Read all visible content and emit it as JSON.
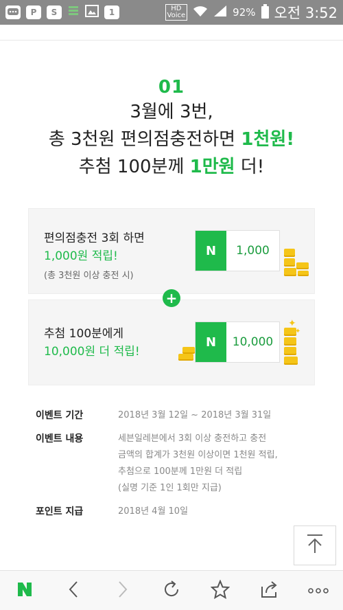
{
  "status_bar": {
    "notification_icons": [
      "chat-icon",
      "p-icon",
      "s-icon",
      "bars-icon",
      "image-icon",
      "one-icon"
    ],
    "one_label": "1",
    "p_label": "P",
    "s_label": "S",
    "hd_label": "HD",
    "voice_label": "Voice",
    "battery": "92%",
    "time": "오전 3:52"
  },
  "event": {
    "number": "01",
    "line1": "3월에 3번,",
    "line2_prefix": "총 3천원 편의점충전하면 ",
    "line2_highlight": "1천원!",
    "line3_prefix": "추첨 100분께 ",
    "line3_highlight": "1만원",
    "line3_suffix": " 더!"
  },
  "benefit1": {
    "title": "편의점충전 3회 하면",
    "highlight": "1,000원 적립!",
    "note": "(총 3천원 이상 충전 시)",
    "card_logo": "N",
    "card_value": "1,000"
  },
  "plus_symbol": "+",
  "benefit2": {
    "title": "추첨 100분에게",
    "highlight": "10,000원 더 적립!",
    "card_logo": "N",
    "card_value": "10,000"
  },
  "info": {
    "period_label": "이벤트 기간",
    "period_value": "2018년  3월 12일 ~ 2018년 3월 31일",
    "content_label": "이벤트 내용",
    "content_lines": [
      "세븐일레븐에서 3회 이상 충전하고 충전",
      "금액의 합계가 3천원 이상이면 1천원 적립,",
      "추첨으로 100분께 1만원 더 적립",
      "(실명 기준 1인 1회만 지급)"
    ],
    "payout_label": "포인트 지급",
    "payout_value": "2018년 4월 10일"
  },
  "bottom_nav": {
    "logo": "N",
    "items": [
      "naver-home",
      "back",
      "forward",
      "refresh",
      "favorite",
      "share",
      "more"
    ]
  },
  "colors": {
    "accent": "#1fba4b",
    "status_bar": "#8a8a8a",
    "coin": "#f5c518"
  }
}
